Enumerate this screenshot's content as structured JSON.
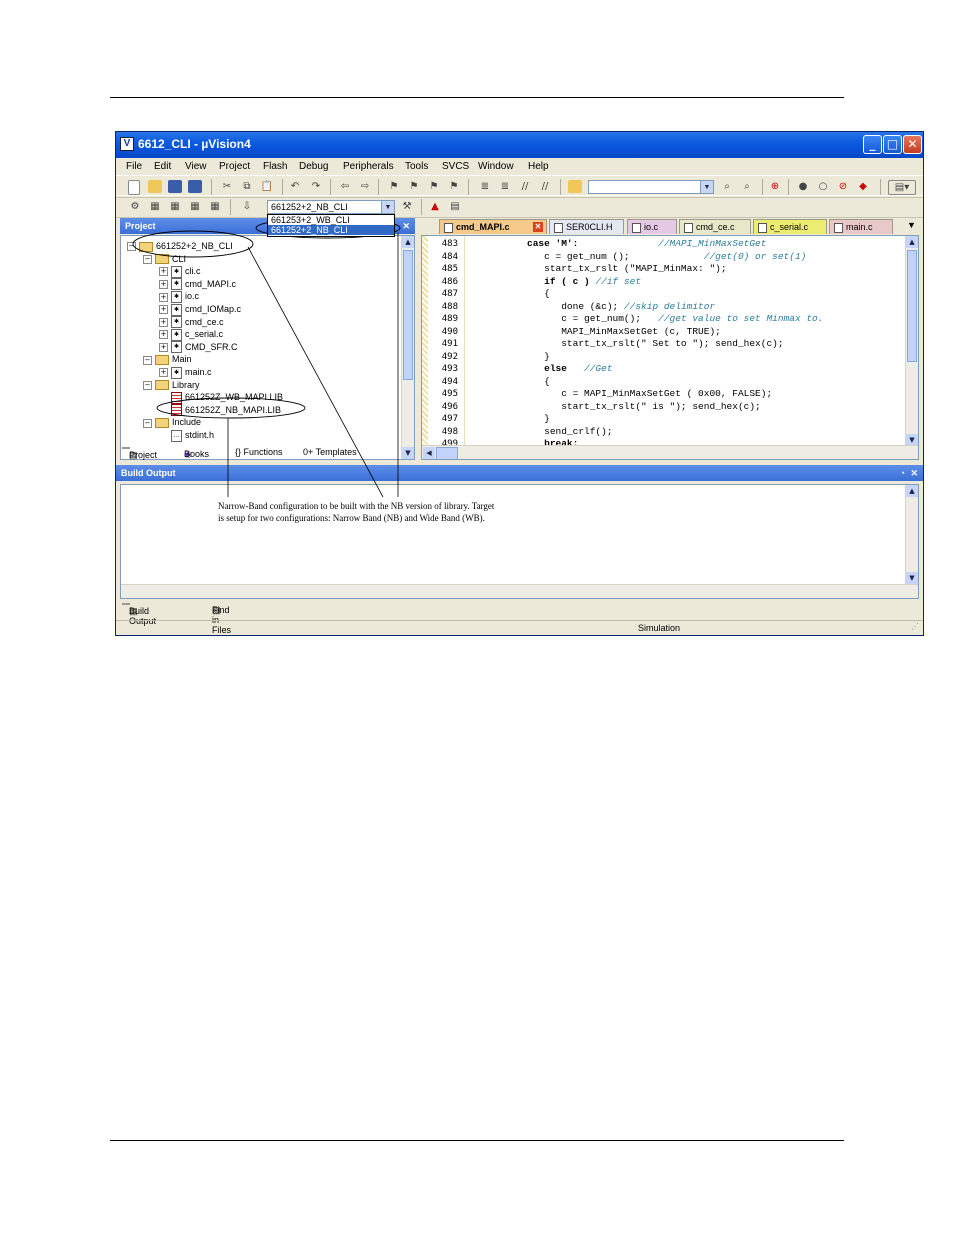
{
  "window": {
    "title": "6612_CLI - µVision4"
  },
  "menu": [
    "File",
    "Edit",
    "View",
    "Project",
    "Flash",
    "Debug",
    "Peripherals",
    "Tools",
    "SVCS",
    "Window",
    "Help"
  ],
  "toolbar": {
    "target_combo": "661252+2_NB_CLI",
    "target_options": [
      "661253+2_WB_CLI",
      "661252+2_NB_CLI"
    ]
  },
  "project_panel": {
    "title": "Project",
    "tree": [
      {
        "label": "661252+2_NB_CLI",
        "type": "root",
        "level": 0
      },
      {
        "label": "CLI",
        "type": "folder",
        "level": 1
      },
      {
        "label": "cli.c",
        "type": "file",
        "level": 2
      },
      {
        "label": "cmd_MAPI.c",
        "type": "file",
        "level": 2
      },
      {
        "label": "io.c",
        "type": "file",
        "level": 2
      },
      {
        "label": "cmd_IOMap.c",
        "type": "file",
        "level": 2
      },
      {
        "label": "cmd_ce.c",
        "type": "file",
        "level": 2
      },
      {
        "label": "c_serial.c",
        "type": "file",
        "level": 2
      },
      {
        "label": "CMD_SFR.C",
        "type": "file",
        "level": 2
      },
      {
        "label": "Main",
        "type": "folder",
        "level": 1
      },
      {
        "label": "main.c",
        "type": "file",
        "level": 2
      },
      {
        "label": "Library",
        "type": "folder",
        "level": 1
      },
      {
        "label": "661252Z_WB_MAPI.LIB",
        "type": "lib",
        "level": 2
      },
      {
        "label": "661252Z_NB_MAPI.LIB",
        "type": "lib",
        "level": 2
      },
      {
        "label": "Include",
        "type": "folder",
        "level": 1
      },
      {
        "label": "stdint.h",
        "type": "header",
        "level": 2
      }
    ],
    "tabs": [
      "Project",
      "Books",
      "{} Functions",
      "0+ Templates"
    ]
  },
  "editor": {
    "tabs": [
      "cmd_MAPI.c",
      "SER0CLI.H",
      "io.c",
      "cmd_ce.c",
      "c_serial.c",
      "main.c"
    ],
    "lines": [
      {
        "n": "483",
        "code": "          case 'M':",
        "comment": "              //MAPI_MinMaxSetGet"
      },
      {
        "n": "484",
        "code": "             c = get_num ();",
        "comment": "             //get(0) or set(1)"
      },
      {
        "n": "485",
        "code": "             start_tx_rslt (\"MAPI_MinMax: \");",
        "comment": ""
      },
      {
        "n": "486",
        "code": "             if ( c )",
        "comment": " //if set"
      },
      {
        "n": "487",
        "code": "             {",
        "comment": ""
      },
      {
        "n": "488",
        "code": "                done (&c);",
        "comment": " //skip delimitor"
      },
      {
        "n": "489",
        "code": "                c = get_num();",
        "comment": "   //get value to set Minmax to."
      },
      {
        "n": "490",
        "code": "                MAPI_MinMaxSetGet (c, TRUE);",
        "comment": ""
      },
      {
        "n": "491",
        "code": "                start_tx_rslt(\" Set to \"); send_hex(c);",
        "comment": ""
      },
      {
        "n": "492",
        "code": "             }",
        "comment": ""
      },
      {
        "n": "493",
        "code": "             else",
        "comment": "   //Get"
      },
      {
        "n": "494",
        "code": "             {",
        "comment": ""
      },
      {
        "n": "495",
        "code": "                c = MAPI_MinMaxSetGet ( 0x00, FALSE);",
        "comment": ""
      },
      {
        "n": "496",
        "code": "                start_tx_rslt(\" is \"); send_hex(c);",
        "comment": ""
      },
      {
        "n": "497",
        "code": "             }",
        "comment": ""
      },
      {
        "n": "498",
        "code": "             send_crlf();",
        "comment": ""
      },
      {
        "n": "499",
        "code": "             break;",
        "comment": ""
      }
    ]
  },
  "build_output": {
    "title": "Build Output",
    "tabs": [
      "Build Output",
      "Find in Files"
    ]
  },
  "status": {
    "mode": "Simulation"
  },
  "annotation": {
    "line1": "Narrow-Band configuration to be built with the NB version of library.  Target",
    "line2": "is setup for two configurations: Narrow Band (NB) and Wide Band (WB)."
  }
}
